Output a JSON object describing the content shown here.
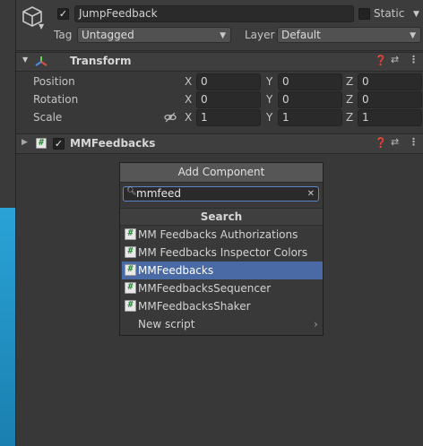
{
  "header": {
    "object_name": "JumpFeedback",
    "static_label": "Static",
    "tag_label": "Tag",
    "tag_value": "Untagged",
    "layer_label": "Layer",
    "layer_value": "Default"
  },
  "transform": {
    "title": "Transform",
    "rows": [
      {
        "label": "Position",
        "x": "0",
        "y": "0",
        "z": "0"
      },
      {
        "label": "Rotation",
        "x": "0",
        "y": "0",
        "z": "0"
      },
      {
        "label": "Scale",
        "x": "1",
        "y": "1",
        "z": "1"
      }
    ],
    "axis": {
      "x": "X",
      "y": "Y",
      "z": "Z"
    }
  },
  "component": {
    "title": "MMFeedbacks"
  },
  "popup": {
    "add_component_label": "Add Component",
    "search_value": "mmfeed",
    "section_title": "Search",
    "items": [
      {
        "label": "MM Feedbacks Authorizations",
        "icon": "script-icon"
      },
      {
        "label": "MM Feedbacks Inspector Colors",
        "icon": "script-icon"
      },
      {
        "label": "MMFeedbacks",
        "icon": "script-icon",
        "selected": true
      },
      {
        "label": "MMFeedbacksSequencer",
        "icon": "script-icon"
      },
      {
        "label": "MMFeedbacksShaker",
        "icon": "script-icon"
      }
    ],
    "new_script_label": "New script"
  },
  "colors": {
    "panel_bg": "#383838",
    "selected_bg": "#4a6aa6",
    "scene_blue": "#1f8fc0"
  }
}
